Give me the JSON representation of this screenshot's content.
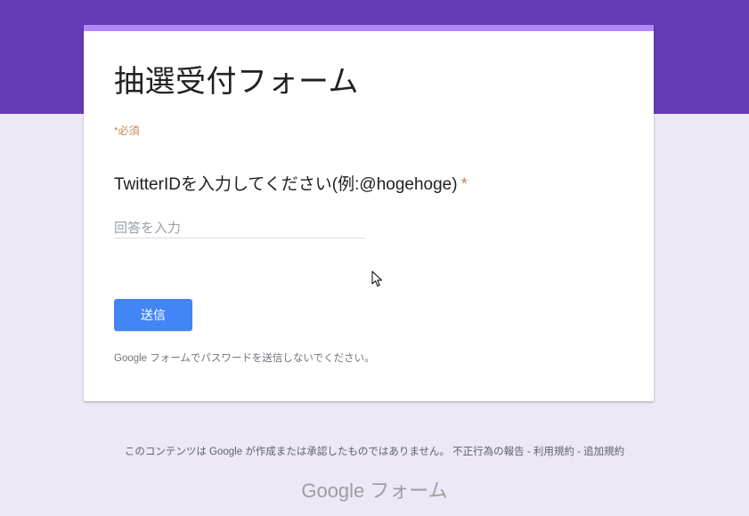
{
  "header": {
    "accent_color": "#673ab7",
    "card_accent_color": "#b388ff"
  },
  "form": {
    "title": "抽選受付フォーム",
    "required_note": "*必須",
    "question": {
      "label": "TwitterIDを入力してください(例:@hogehoge)",
      "required_marker": "*",
      "placeholder": "回答を入力",
      "value": ""
    },
    "submit_label": "送信",
    "submit_color": "#4285f4",
    "password_warning": "Google フォームでパスワードを送信しないでください。"
  },
  "footer": {
    "disclaimer": "このコンテンツは Google が作成または承認したものではありません。",
    "report_link": "不正行為の報告",
    "separator": " - ",
    "terms_link": "利用規約",
    "additional_terms_link": "追加規約"
  },
  "brand": {
    "google": "Google",
    "forms": "フォーム"
  },
  "cursor": {
    "icon": "mouse-pointer-icon"
  }
}
